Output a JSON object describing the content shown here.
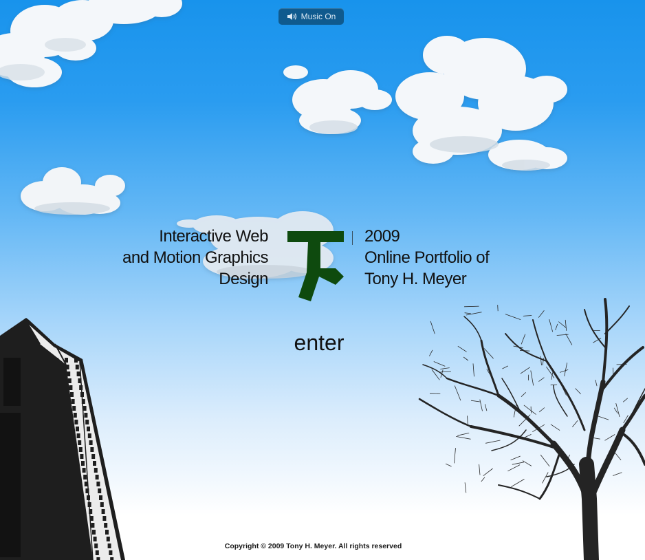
{
  "music_toggle": {
    "label": "Music On",
    "icon": "speaker-icon"
  },
  "intro": {
    "left_lines": [
      "Interactive Web",
      "and Motion Graphics",
      "Design"
    ],
    "right_lines": [
      "2009",
      "Online Portfolio of",
      "Tony H. Meyer"
    ]
  },
  "logo": {
    "icon": "th-monogram-logo",
    "color": "#0e4a0e"
  },
  "enter_label": "enter",
  "footer": {
    "copyright": "Copyright © 2009 Tony H. Meyer. All rights reserved"
  },
  "colors": {
    "sky_top": "#1893ec",
    "sky_bottom": "#ffffff",
    "music_button_bg": "#0f5a8e",
    "silhouette": "#1e1e1e"
  }
}
